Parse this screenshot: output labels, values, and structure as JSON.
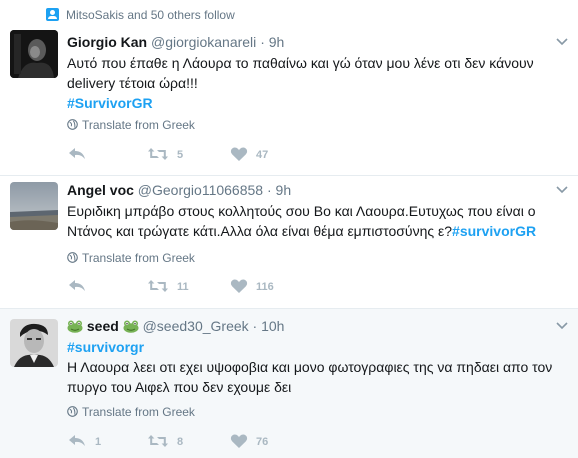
{
  "social_context": {
    "text": "MitsoSakis and 50 others follow"
  },
  "tweets": [
    {
      "name": "Giorgio Kan",
      "handle": "@giorgiokanareli",
      "dot": "·",
      "time": "9h",
      "text": "Αυτό που έπαθε η Λάουρα το παθαίνω και γώ όταν μου λένε οτι δεν κάνουν delivery τέτοια ώρα!!!",
      "hashtag": "#SurvivorGR",
      "translate": "Translate from Greek",
      "replies": "",
      "retweets": "5",
      "likes": "47"
    },
    {
      "name": "Angel voc",
      "handle": "@Georgio11066858",
      "dot": "·",
      "time": "9h",
      "text": "Ευριδικη μπράβο στους κολλητούς σου Βο και Λαουρα.Ευτυχως που είναι ο Ντάνος και τρώγατε κάτι.Αλλα όλα είναι θέμα εμπιστοσύνης ε?",
      "hashtag": "#survivorGR",
      "translate": "Translate from Greek",
      "replies": "",
      "retweets": "11",
      "likes": "116"
    },
    {
      "name": "seed",
      "handle": "@seed30_Greek",
      "dot": "·",
      "time": "10h",
      "hashtag": "#survivorgr",
      "text": "Η Λαουρα λεει οτι εχει υψοφοβια και μονο φωτογραφιες της να πηδαει απο τον πυργο του Αιφελ που δεν εχουμε δει",
      "translate": "Translate from Greek",
      "replies": "1",
      "retweets": "8",
      "likes": "76"
    }
  ],
  "colors": {
    "link": "#1da1f2",
    "muted": "#657786",
    "icon": "#aab8c2",
    "highlight_bg": "#f5f8fa"
  },
  "icons": [
    "person-icon",
    "caret-down-icon",
    "globe-icon",
    "reply-icon",
    "retweet-icon",
    "like-icon",
    "frog-emoji-icon"
  ]
}
